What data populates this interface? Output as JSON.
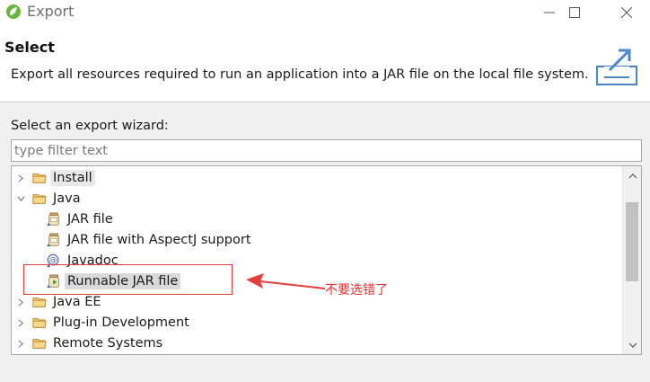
{
  "window": {
    "title": "Export"
  },
  "banner": {
    "title": "Select",
    "description": "Export all resources required to run an application into a JAR file on the local file system."
  },
  "wizard": {
    "label": "Select an export wizard:",
    "filter_placeholder": "type filter text",
    "filter_value": ""
  },
  "tree": {
    "items": [
      {
        "label": "Install",
        "kind": "folder",
        "expanded": false,
        "level": 0,
        "state": "hover"
      },
      {
        "label": "Java",
        "kind": "folder",
        "expanded": true,
        "level": 0
      },
      {
        "label": "JAR file",
        "kind": "jar",
        "level": 1
      },
      {
        "label": "JAR file with AspectJ support",
        "kind": "jar",
        "level": 1
      },
      {
        "label": "Javadoc",
        "kind": "javadoc",
        "level": 1
      },
      {
        "label": "Runnable JAR file",
        "kind": "runnable-jar",
        "level": 1,
        "state": "selected"
      },
      {
        "label": "Java EE",
        "kind": "folder",
        "expanded": false,
        "level": 0
      },
      {
        "label": "Plug-in Development",
        "kind": "folder",
        "expanded": false,
        "level": 0
      },
      {
        "label": "Remote Systems",
        "kind": "folder",
        "expanded": false,
        "level": 0
      }
    ]
  },
  "annotation": {
    "text": "不要选错了",
    "color": "#e53e3e"
  },
  "colors": {
    "folder": "#e8b04c",
    "selection": "#d9d9d9",
    "spring_green": "#6db33f"
  }
}
